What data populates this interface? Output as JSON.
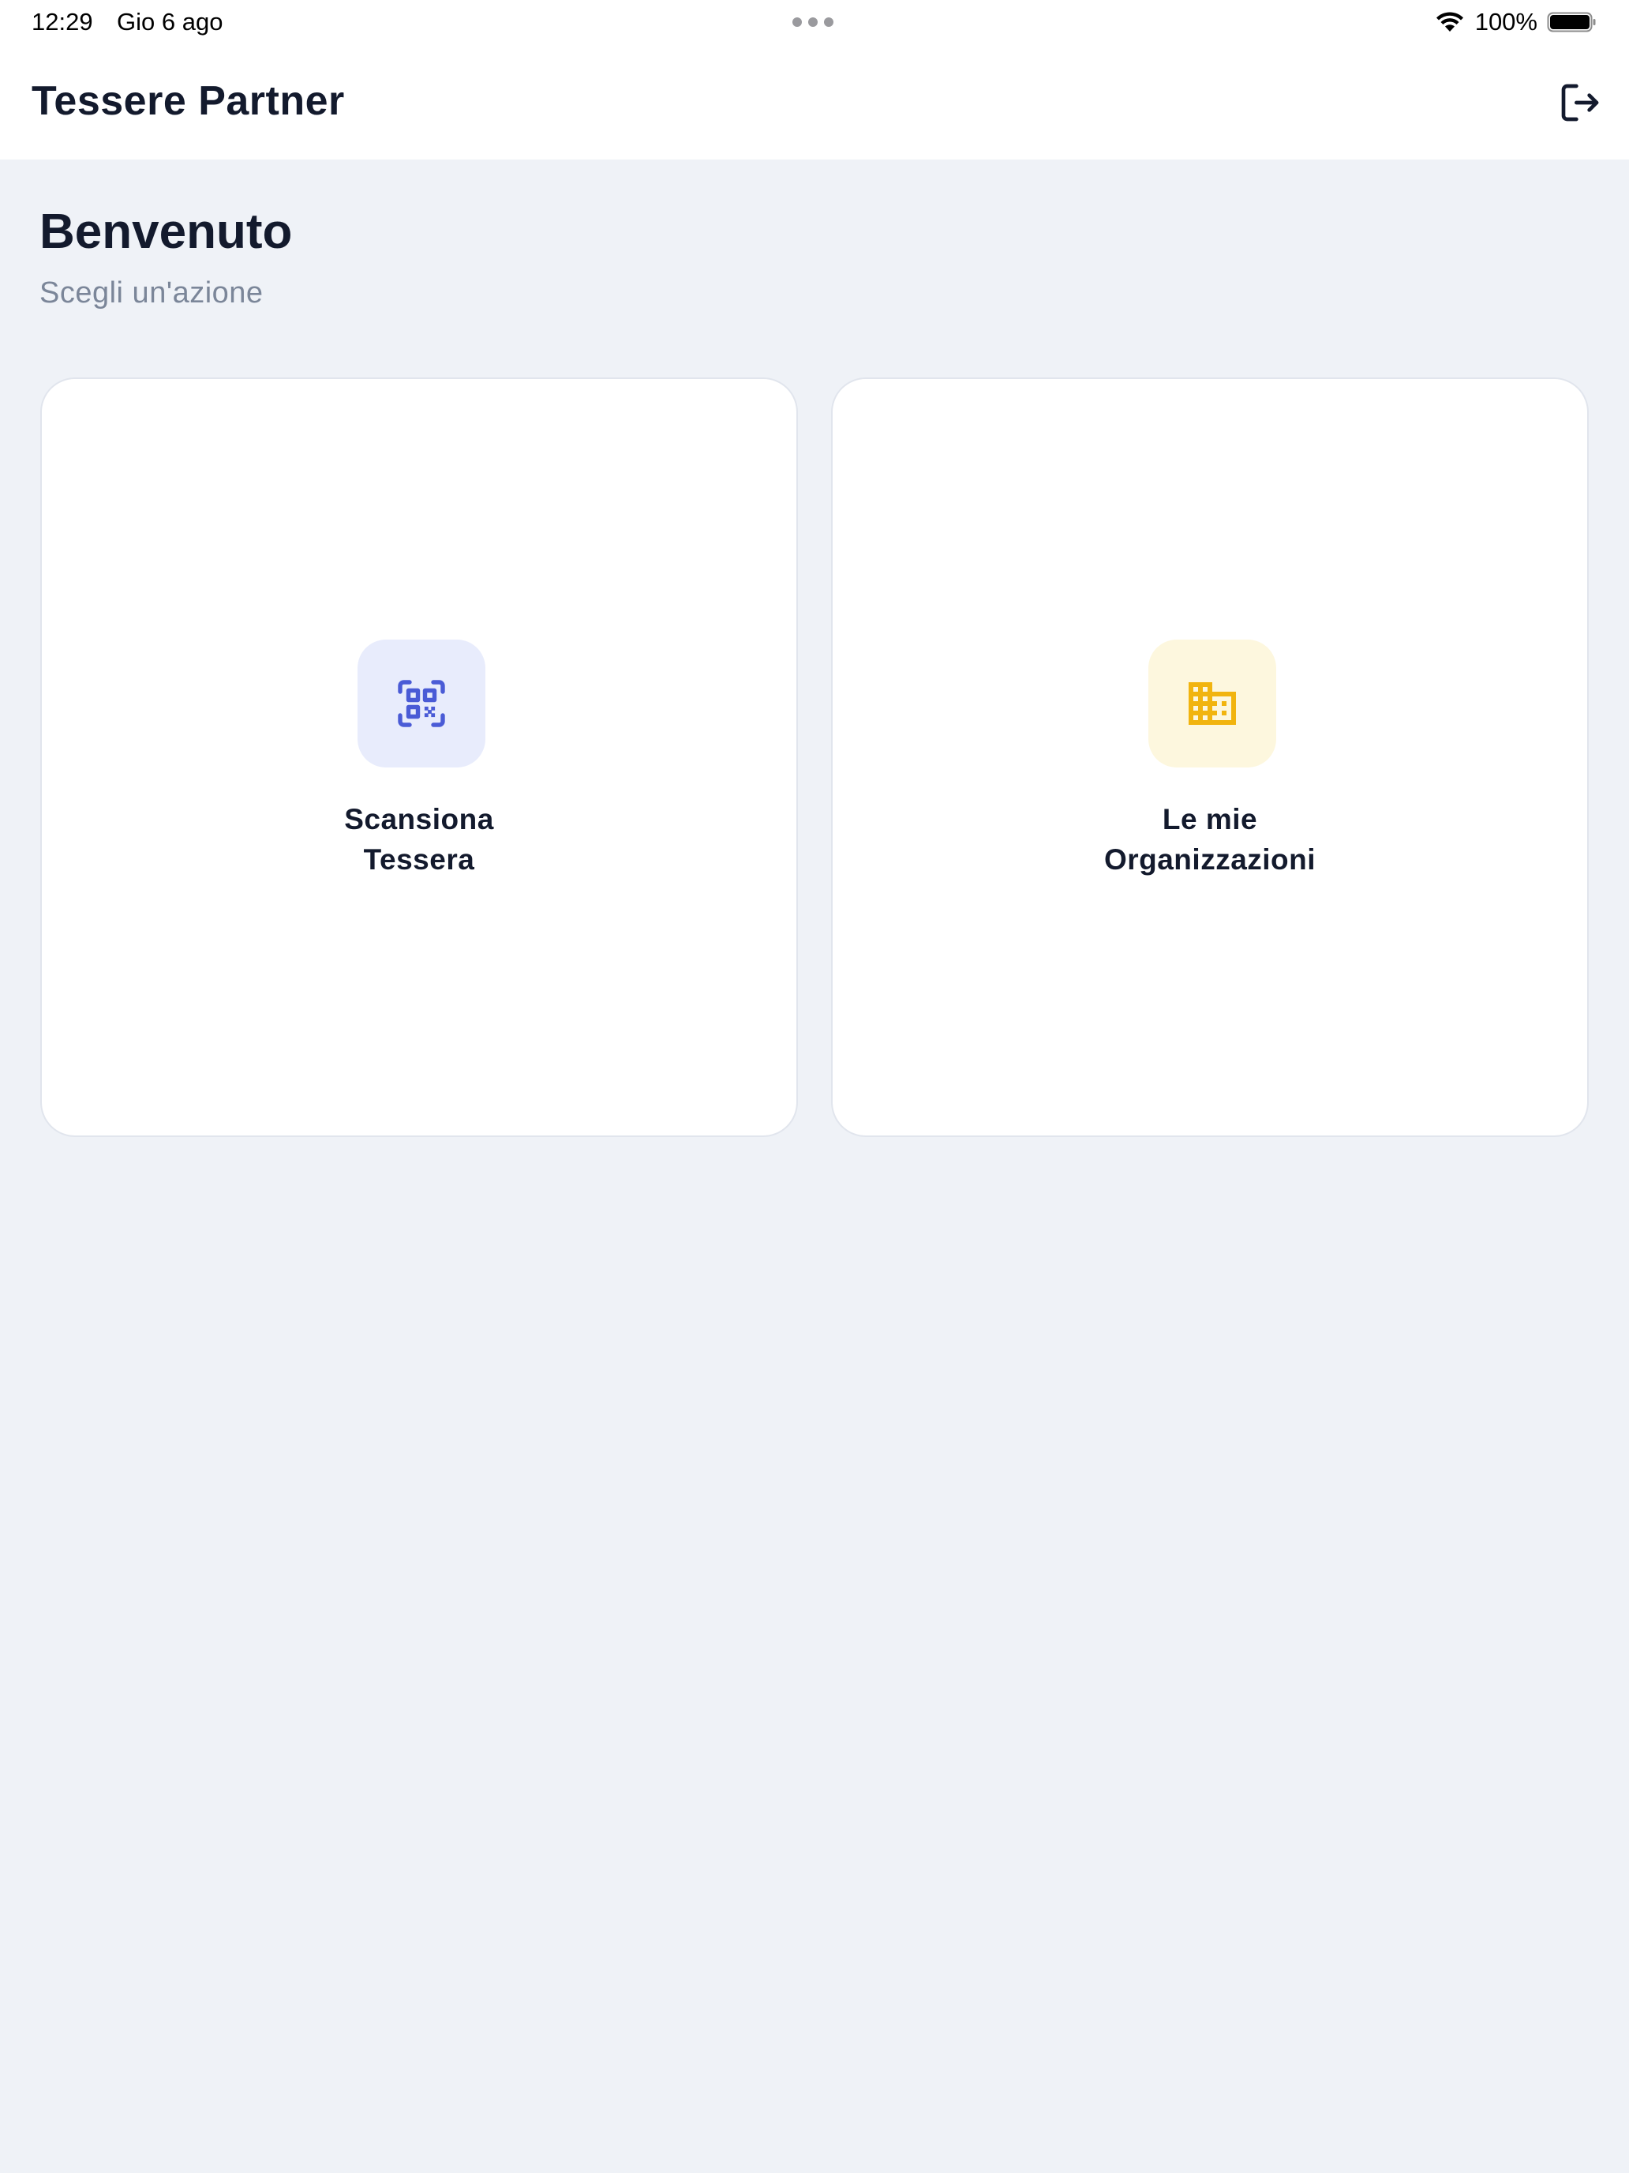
{
  "status_bar": {
    "time": "12:29",
    "date": "Gio 6 ago",
    "battery": "100%"
  },
  "header": {
    "title": "Tessere Partner",
    "logout_icon": "logout-icon"
  },
  "welcome": {
    "title": "Benvenuto",
    "subtitle": "Scegli un'azione"
  },
  "cards": [
    {
      "line1": "Scansiona",
      "line2": "Tessera",
      "icon": "qr-code-scan-icon",
      "icon_color": "#4a5bd6",
      "icon_bg": "#e8ecfc"
    },
    {
      "line1": "Le mie",
      "line2": "Organizzazioni",
      "icon": "building-icon",
      "icon_color": "#f1b40f",
      "icon_bg": "#fdf7de"
    }
  ],
  "colors": {
    "background": "#eff2f7",
    "surface": "#ffffff",
    "text_primary": "#131a2d",
    "text_secondary": "#7b8699"
  }
}
